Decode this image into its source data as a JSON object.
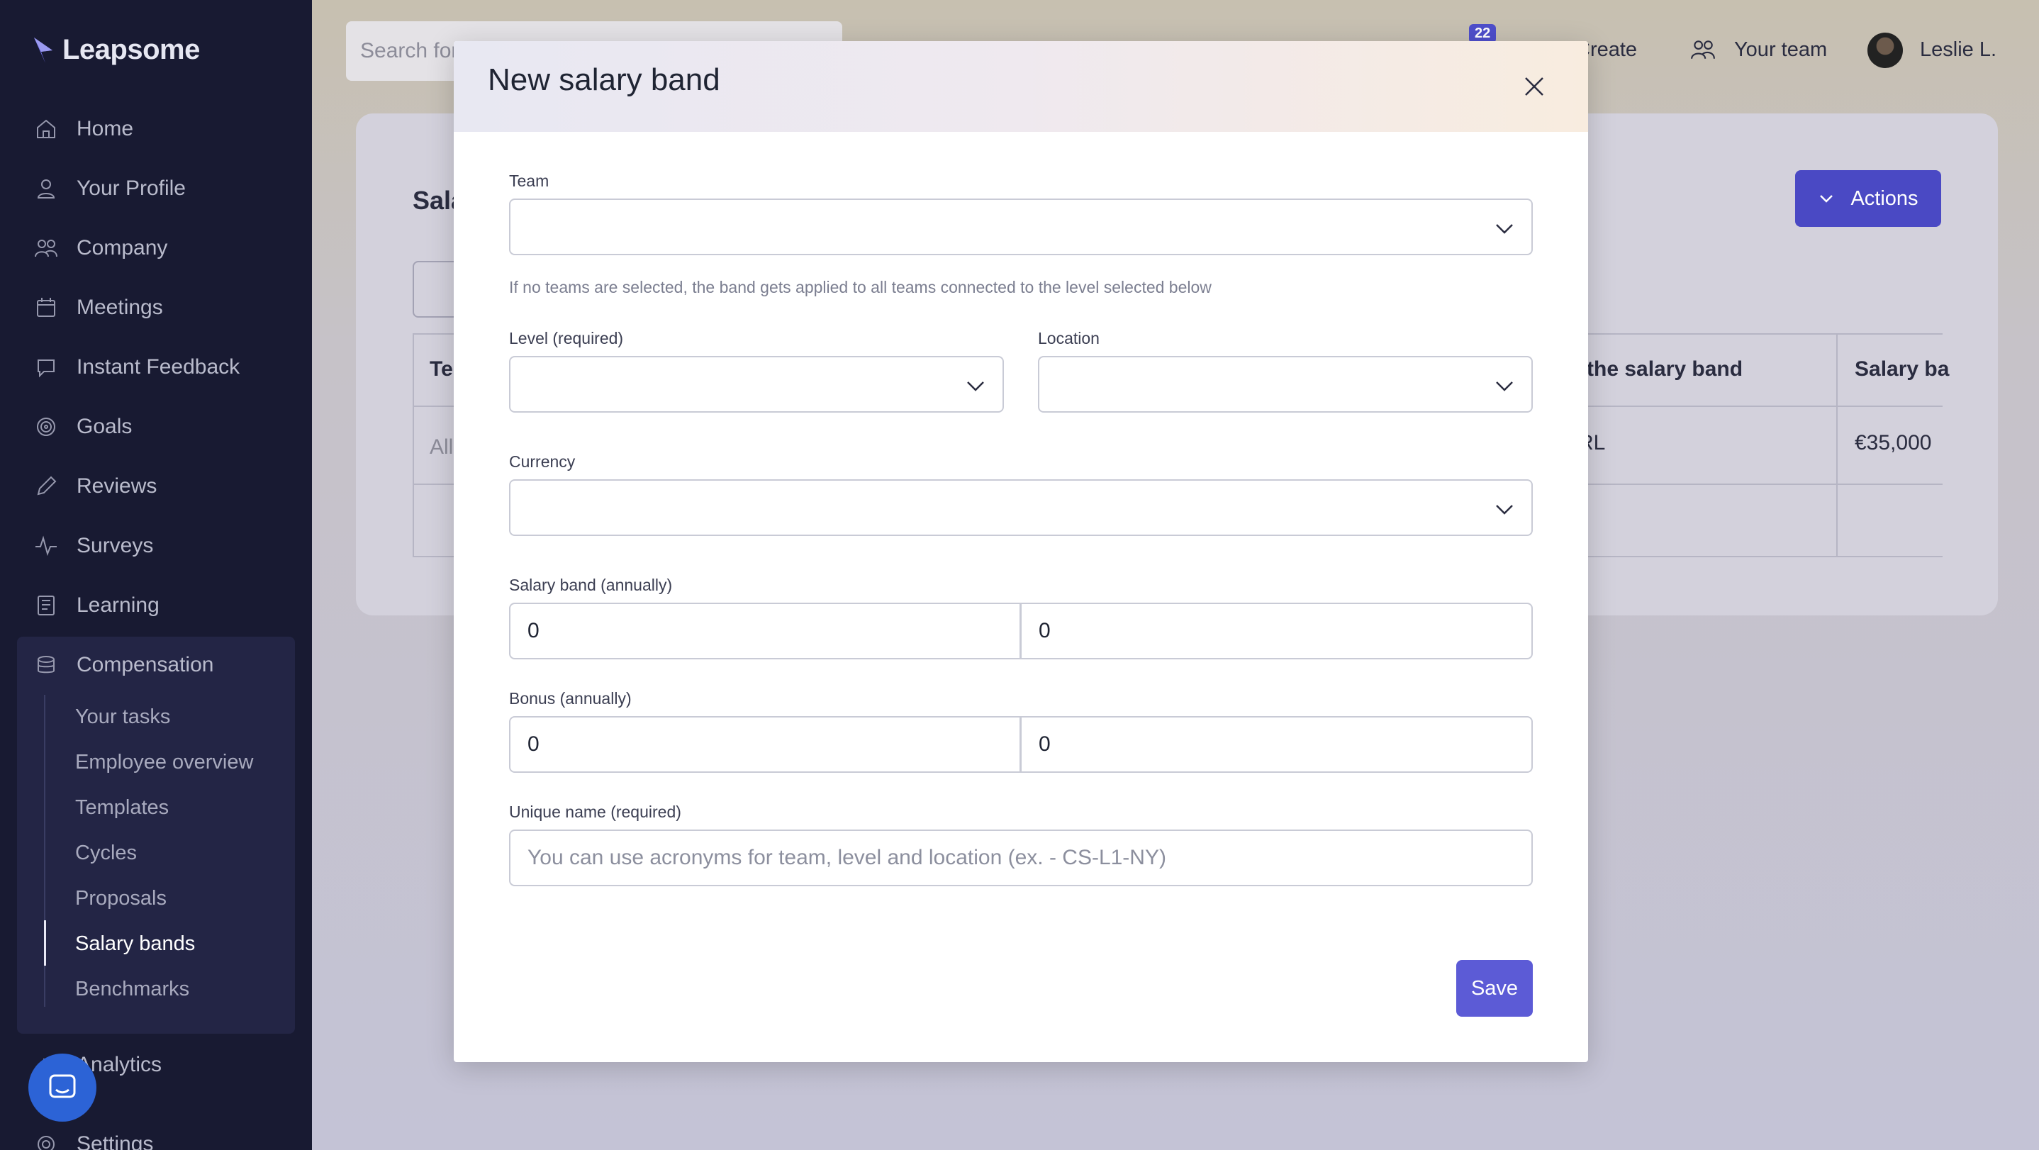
{
  "app": {
    "name": "Leapsome"
  },
  "sidebar": {
    "items": [
      {
        "label": "Home",
        "icon": "home-icon"
      },
      {
        "label": "Your Profile",
        "icon": "user-icon"
      },
      {
        "label": "Company",
        "icon": "users-icon"
      },
      {
        "label": "Meetings",
        "icon": "calendar-icon"
      },
      {
        "label": "Instant Feedback",
        "icon": "chat-icon"
      },
      {
        "label": "Goals",
        "icon": "target-icon"
      },
      {
        "label": "Reviews",
        "icon": "pencil-icon"
      },
      {
        "label": "Surveys",
        "icon": "pulse-icon"
      },
      {
        "label": "Learning",
        "icon": "book-icon"
      },
      {
        "label": "Compensation",
        "icon": "coins-icon"
      }
    ],
    "compensation_subitems": [
      "Your tasks",
      "Employee overview",
      "Templates",
      "Cycles",
      "Proposals",
      "Salary bands",
      "Benchmarks"
    ],
    "active_subitem": "Salary bands",
    "after_items": [
      {
        "label": "Analytics"
      },
      {
        "label": "Settings"
      }
    ]
  },
  "topbar": {
    "search_placeholder": "Search for",
    "notification_count": "22",
    "create_label": "Create",
    "your_team_label": "Your team",
    "user_name": "Leslie L."
  },
  "page": {
    "title_partial": "Sala",
    "actions_label": "Actions",
    "table": {
      "headers": [
        "Te",
        "the salary band",
        "Salary ba"
      ],
      "row": {
        "team_partial": "All",
        "location_partial": "RL",
        "salary": "€35,000"
      }
    }
  },
  "modal": {
    "title": "New salary band",
    "team": {
      "label": "Team",
      "hint": "If no teams are selected, the band gets applied to all teams connected to the level selected below"
    },
    "level": {
      "label": "Level (required)"
    },
    "location": {
      "label": "Location"
    },
    "currency": {
      "label": "Currency"
    },
    "salary_band": {
      "label": "Salary band (annually)",
      "min": "0",
      "max": "0"
    },
    "bonus": {
      "label": "Bonus (annually)",
      "min": "0",
      "max": "0"
    },
    "unique_name": {
      "label": "Unique name (required)",
      "placeholder": "You can use acronyms for team, level and location (ex. - CS-L1-NY)"
    },
    "save_label": "Save"
  },
  "colors": {
    "sidebar_bg": "#181a32",
    "accent": "#5c5bd6",
    "actions_button": "#4a49c4"
  }
}
